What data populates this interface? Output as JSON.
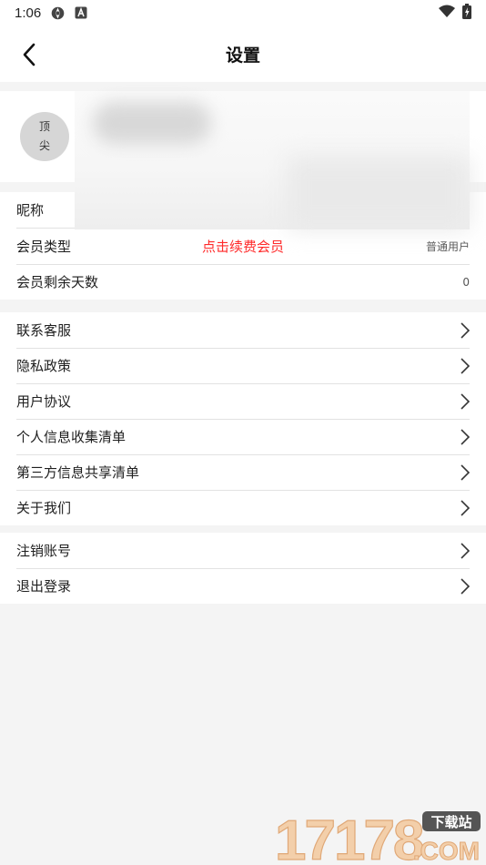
{
  "status_bar": {
    "time": "1:06",
    "icons": [
      "settings-gear-icon",
      "a-badge-icon",
      "wifi-icon",
      "battery-charging-icon"
    ]
  },
  "header": {
    "title": "设置",
    "back_icon": "back-arrow-icon"
  },
  "profile": {
    "avatar_text_line1": "顶",
    "avatar_text_line2": "尖"
  },
  "account": {
    "nickname_label": "昵称",
    "member_type_label": "会员类型",
    "member_promo": "点击续费会员",
    "member_type_value": "普通用户",
    "remaining_days_label": "会员剩余天数",
    "remaining_days_value": "0"
  },
  "menu": [
    {
      "label": "联系客服"
    },
    {
      "label": "隐私政策"
    },
    {
      "label": "用户协议"
    },
    {
      "label": "个人信息收集清单"
    },
    {
      "label": "第三方信息共享清单"
    },
    {
      "label": "关于我们"
    }
  ],
  "account_actions": [
    {
      "label": "注销账号"
    },
    {
      "label": "退出登录"
    }
  ],
  "watermark": {
    "number": "17178",
    "badge": "下载站",
    "domain": ".COM"
  },
  "colors": {
    "promo": "#ff2a2a",
    "background": "#f4f4f4",
    "watermark": "#f0c9a3"
  }
}
